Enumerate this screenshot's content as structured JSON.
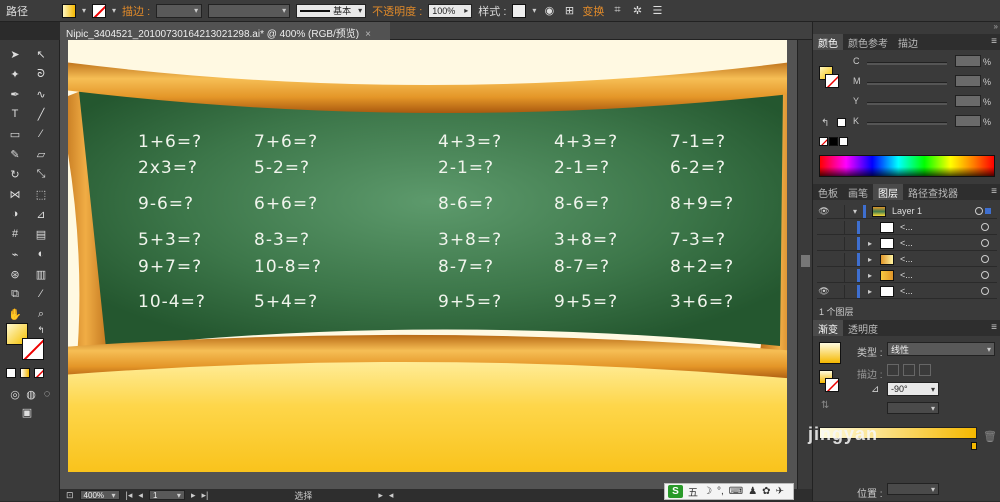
{
  "control_bar": {
    "object_type": "路径",
    "stroke_label": "描边 :",
    "stroke_profile": "基本",
    "opacity_label": "不透明度 :",
    "opacity_value": "100%",
    "style_label": "样式 :",
    "transform_label": "变换"
  },
  "document_tab": {
    "title": "Nipic_3404521_20100730164213021298.ai* @ 400% (RGB/预览)",
    "close": "×"
  },
  "chalkboard": {
    "equations": [
      [
        "1+6=?",
        "7+6=?",
        "4+3=?",
        "4+3=?",
        "7-1=?"
      ],
      [
        "2x3=?",
        "5-2=?",
        "2-1=?",
        "2-1=?",
        "6-2=?"
      ],
      [
        "9-6=?",
        "6+6=?",
        "8-6=?",
        "8-6=?",
        "8+9=?"
      ],
      [
        "5+3=?",
        "8-3=?",
        "3+8=?",
        "3+8=?",
        "7-3=?"
      ],
      [
        "9+7=?",
        "10-8=?",
        "8-7=?",
        "8-7=?",
        "8+2=?"
      ],
      [
        "10-4=?",
        "5+4=?",
        "9+5=?",
        "9+5=?",
        "3+6=?"
      ]
    ]
  },
  "status_bar": {
    "zoom": "400%",
    "page": "1",
    "tool": "选择"
  },
  "ime_bar": {
    "logo": "S",
    "mode": "五"
  },
  "color_panel": {
    "tabs": [
      "颜色",
      "颜色参考",
      "描边"
    ],
    "channels": [
      "C",
      "M",
      "Y",
      "K"
    ],
    "unit": "%"
  },
  "layers_panel": {
    "tabs": [
      "色板",
      "画笔",
      "图层",
      "路径查找器"
    ],
    "layer_name": "Layer 1",
    "sublayer_name": "<...",
    "footer": "1 个图层"
  },
  "gradient_panel": {
    "tabs": [
      "渐变",
      "透明度"
    ],
    "type_label": "类型 :",
    "type_value": "线性",
    "stroke_label": "描边 :",
    "angle_value": "-90°",
    "position_label": "位置 :"
  },
  "watermark": "jingyan",
  "colors": {
    "board_green": "#3f7a4e",
    "frame_orange": "#e0962a",
    "artboard_yellow": "#fdd835",
    "chalk": "#f0f4ec"
  }
}
